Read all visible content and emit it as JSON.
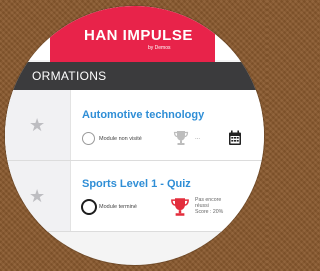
{
  "app": {
    "brand_title": "HAN IMPULSE",
    "brand_subtitle": "by Demos",
    "brand_color": "#e8234a"
  },
  "section": {
    "title": "ORMATIONS"
  },
  "modules": [
    {
      "title": "Automotive technology",
      "status": "Module non visité",
      "trophy_state": "grey",
      "trophy_text": "...",
      "starred": false
    },
    {
      "title": "Sports Level 1 - Quiz",
      "status": "Module terminé",
      "trophy_state": "red",
      "trophy_lines": [
        "Pas encore",
        "réussi",
        "Score : 20%"
      ],
      "starred": false
    }
  ],
  "icons": {
    "star": "star-icon",
    "calendar": "calendar-icon",
    "trophy": "trophy-icon"
  },
  "colors": {
    "accent_link": "#2f8ed6",
    "header_dark": "#3b3b3d",
    "trophy_red": "#e32d3c",
    "trophy_grey": "#bdbdbd"
  }
}
